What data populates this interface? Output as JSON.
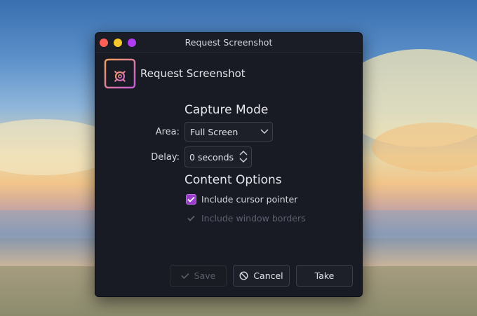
{
  "window": {
    "title": "Request Screenshot"
  },
  "header": {
    "title": "Request Screenshot",
    "icon": "screenshot-settings-icon"
  },
  "capture_mode": {
    "heading": "Capture Mode",
    "area_label": "Area:",
    "area_value": "Full Screen",
    "delay_label": "Delay:",
    "delay_value": "0 seconds"
  },
  "content_options": {
    "heading": "Content Options",
    "include_cursor_pointer": {
      "label": "Include cursor pointer",
      "checked": true
    },
    "include_window_borders": {
      "label": "Include window borders",
      "checked": true,
      "disabled": true
    }
  },
  "buttons": {
    "save": "Save",
    "cancel": "Cancel",
    "take": "Take"
  },
  "colors": {
    "window_bg": "#181a24",
    "accent_purple": "#9b3cc9",
    "close_red": "#ff5f57",
    "minimize_yellow": "#f7c62c",
    "maximize_purple": "#b23cf3",
    "icon_gradient_start": "#f0a25a",
    "icon_gradient_end": "#c55ad8"
  }
}
